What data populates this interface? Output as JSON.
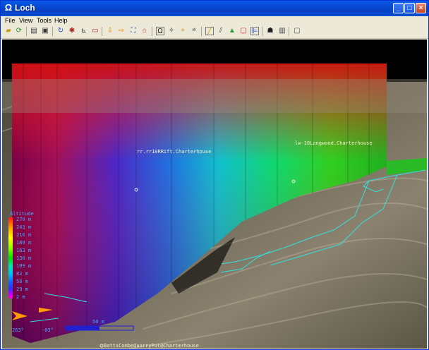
{
  "window": {
    "title": "Loch",
    "app_icon_glyph": "Ω"
  },
  "menu": {
    "file": "File",
    "view": "View",
    "tools": "Tools",
    "help": "Help"
  },
  "toolbar": {
    "icons": [
      "open-folder-icon",
      "reload-icon",
      "print-icon",
      "print-preview-icon",
      "rotate-icon",
      "color-icon",
      "measure-icon",
      "scale-icon",
      "move-down-icon",
      "move-right-icon",
      "fullscreen-icon",
      "home-icon",
      "loop-icon",
      "target-icon",
      "plus-icon",
      "labels-icon",
      "leg-color-icon",
      "tubes-icon",
      "terrain-icon",
      "box-icon",
      "tree-icon",
      "person-icon",
      "info-icon",
      "window-icon"
    ]
  },
  "viewport": {
    "labels": {
      "rift": "rr.rr10RRift.Charterhouse",
      "longwood": "lw-10Longwood.Charterhouse",
      "batts": "BattsCombeQuarryPot@Charterhouse"
    },
    "legend": {
      "title": "Altitude",
      "ticks": [
        "270 m",
        "243 m",
        "216 m",
        "189 m",
        "163 m",
        "136 m",
        "109 m",
        "82 m",
        "56 m",
        "29 m",
        "2 m"
      ],
      "colors": [
        "#ff1a1a",
        "#ff9a00",
        "#ffff00",
        "#8cff00",
        "#00e000",
        "#00e8b0",
        "#00c0ff",
        "#1a60ff",
        "#3030ff",
        "#c000ff",
        "#ff00c8"
      ]
    },
    "compass": {
      "heading": "263°",
      "tilt": "-03°"
    },
    "scale_bar": {
      "label": "50 m"
    }
  }
}
